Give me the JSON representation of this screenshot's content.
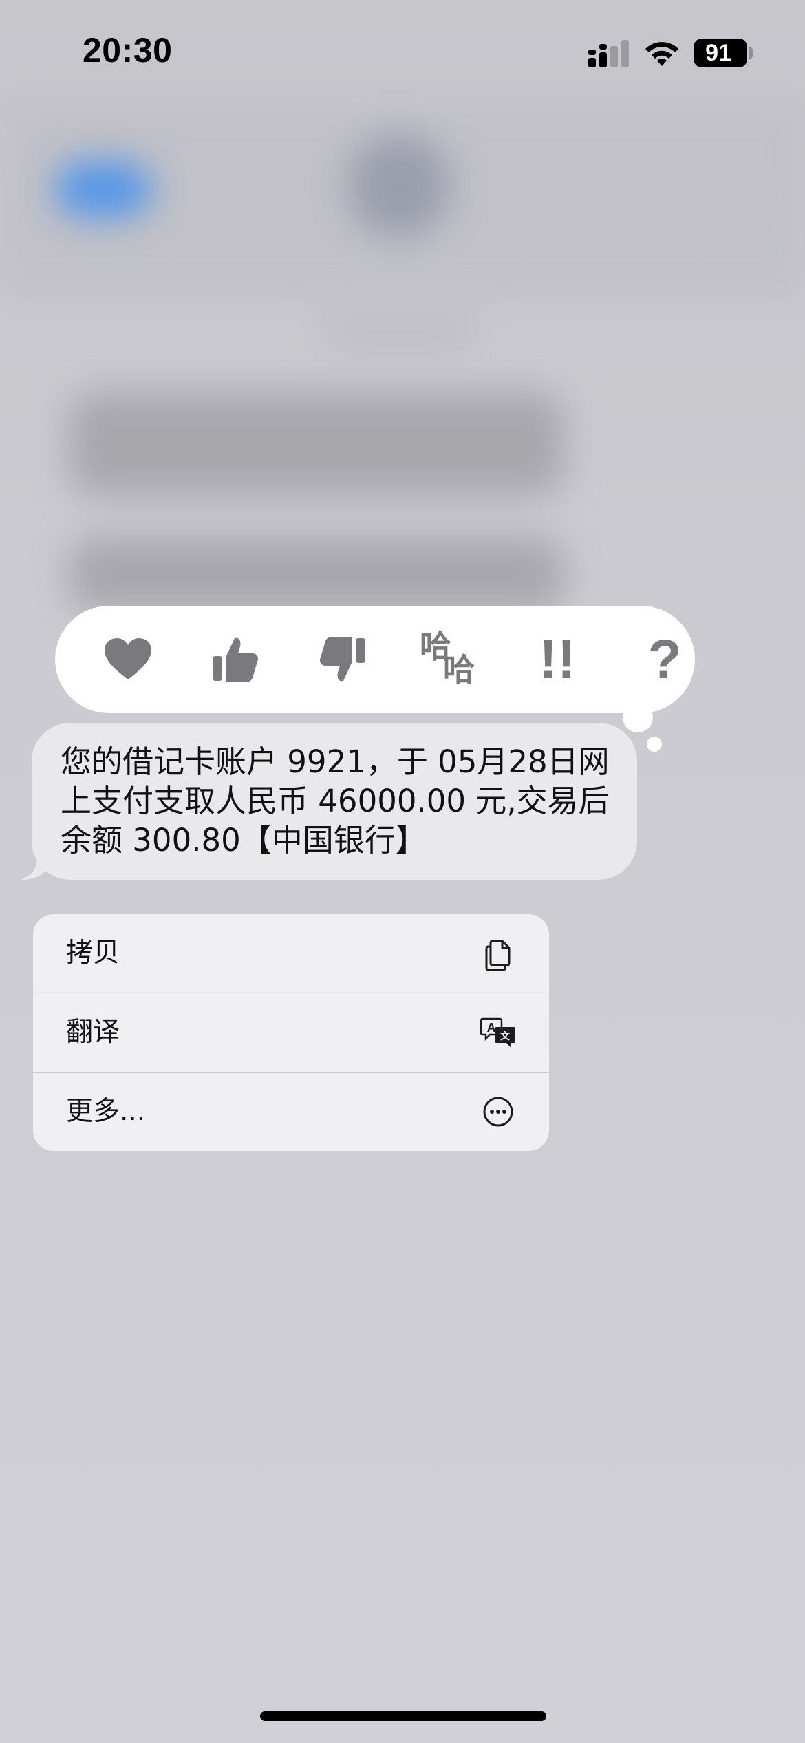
{
  "status_bar": {
    "time": "20:30",
    "battery_percent": "91",
    "signal_icon": "cellular-signal-icon",
    "wifi_icon": "wifi-icon",
    "battery_icon": "battery-icon"
  },
  "tapback": {
    "reactions": [
      {
        "name": "heart",
        "icon": "heart-icon"
      },
      {
        "name": "thumbs-up",
        "icon": "thumbs-up-icon"
      },
      {
        "name": "thumbs-down",
        "icon": "thumbs-down-icon"
      },
      {
        "name": "haha",
        "icon": "haha-icon",
        "glyphs": [
          "哈",
          "哈"
        ]
      },
      {
        "name": "emphasize",
        "icon": "double-exclamation-icon",
        "glyph": "!!"
      },
      {
        "name": "question",
        "icon": "question-mark-icon",
        "glyph": "?"
      }
    ],
    "icon_color": "#7a7a7e"
  },
  "message": {
    "lines": [
      "您的借记卡账户 9921，于 05月28日网",
      "上支付支取人民币 46000.00 元,交易后",
      "余额 300.80【中国银行】"
    ],
    "bubble_color": "#e9e9ec"
  },
  "context_menu": {
    "items": [
      {
        "label": "拷贝",
        "icon": "copy-icon"
      },
      {
        "label": "翻译",
        "icon": "translate-icon"
      },
      {
        "label": "更多...",
        "icon": "ellipsis-circle-icon"
      }
    ]
  },
  "colors": {
    "background": "#cbcbd1",
    "accent_blue": "#3f8df0"
  }
}
